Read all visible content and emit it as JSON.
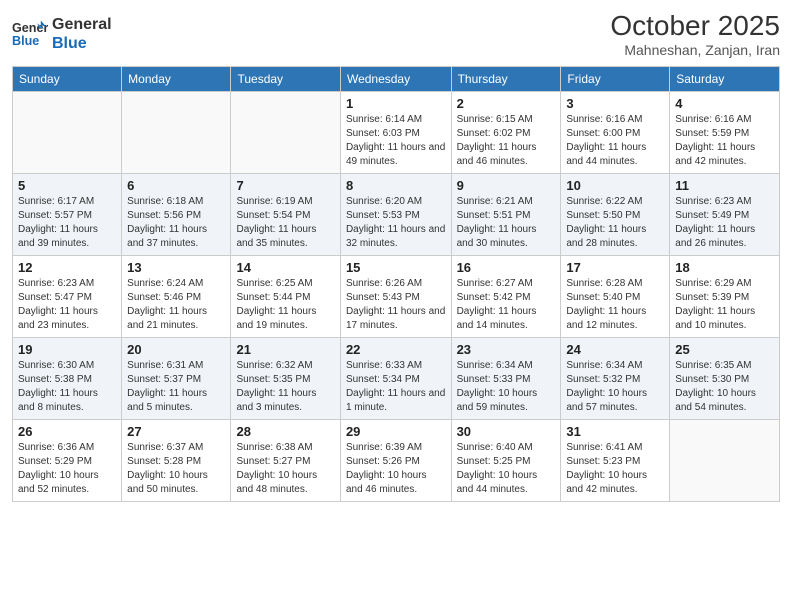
{
  "header": {
    "logo_line1": "General",
    "logo_line2": "Blue",
    "month": "October 2025",
    "location": "Mahneshan, Zanjan, Iran"
  },
  "weekdays": [
    "Sunday",
    "Monday",
    "Tuesday",
    "Wednesday",
    "Thursday",
    "Friday",
    "Saturday"
  ],
  "weeks": [
    [
      {
        "day": "",
        "info": ""
      },
      {
        "day": "",
        "info": ""
      },
      {
        "day": "",
        "info": ""
      },
      {
        "day": "1",
        "info": "Sunrise: 6:14 AM\nSunset: 6:03 PM\nDaylight: 11 hours and 49 minutes."
      },
      {
        "day": "2",
        "info": "Sunrise: 6:15 AM\nSunset: 6:02 PM\nDaylight: 11 hours and 46 minutes."
      },
      {
        "day": "3",
        "info": "Sunrise: 6:16 AM\nSunset: 6:00 PM\nDaylight: 11 hours and 44 minutes."
      },
      {
        "day": "4",
        "info": "Sunrise: 6:16 AM\nSunset: 5:59 PM\nDaylight: 11 hours and 42 minutes."
      }
    ],
    [
      {
        "day": "5",
        "info": "Sunrise: 6:17 AM\nSunset: 5:57 PM\nDaylight: 11 hours and 39 minutes."
      },
      {
        "day": "6",
        "info": "Sunrise: 6:18 AM\nSunset: 5:56 PM\nDaylight: 11 hours and 37 minutes."
      },
      {
        "day": "7",
        "info": "Sunrise: 6:19 AM\nSunset: 5:54 PM\nDaylight: 11 hours and 35 minutes."
      },
      {
        "day": "8",
        "info": "Sunrise: 6:20 AM\nSunset: 5:53 PM\nDaylight: 11 hours and 32 minutes."
      },
      {
        "day": "9",
        "info": "Sunrise: 6:21 AM\nSunset: 5:51 PM\nDaylight: 11 hours and 30 minutes."
      },
      {
        "day": "10",
        "info": "Sunrise: 6:22 AM\nSunset: 5:50 PM\nDaylight: 11 hours and 28 minutes."
      },
      {
        "day": "11",
        "info": "Sunrise: 6:23 AM\nSunset: 5:49 PM\nDaylight: 11 hours and 26 minutes."
      }
    ],
    [
      {
        "day": "12",
        "info": "Sunrise: 6:23 AM\nSunset: 5:47 PM\nDaylight: 11 hours and 23 minutes."
      },
      {
        "day": "13",
        "info": "Sunrise: 6:24 AM\nSunset: 5:46 PM\nDaylight: 11 hours and 21 minutes."
      },
      {
        "day": "14",
        "info": "Sunrise: 6:25 AM\nSunset: 5:44 PM\nDaylight: 11 hours and 19 minutes."
      },
      {
        "day": "15",
        "info": "Sunrise: 6:26 AM\nSunset: 5:43 PM\nDaylight: 11 hours and 17 minutes."
      },
      {
        "day": "16",
        "info": "Sunrise: 6:27 AM\nSunset: 5:42 PM\nDaylight: 11 hours and 14 minutes."
      },
      {
        "day": "17",
        "info": "Sunrise: 6:28 AM\nSunset: 5:40 PM\nDaylight: 11 hours and 12 minutes."
      },
      {
        "day": "18",
        "info": "Sunrise: 6:29 AM\nSunset: 5:39 PM\nDaylight: 11 hours and 10 minutes."
      }
    ],
    [
      {
        "day": "19",
        "info": "Sunrise: 6:30 AM\nSunset: 5:38 PM\nDaylight: 11 hours and 8 minutes."
      },
      {
        "day": "20",
        "info": "Sunrise: 6:31 AM\nSunset: 5:37 PM\nDaylight: 11 hours and 5 minutes."
      },
      {
        "day": "21",
        "info": "Sunrise: 6:32 AM\nSunset: 5:35 PM\nDaylight: 11 hours and 3 minutes."
      },
      {
        "day": "22",
        "info": "Sunrise: 6:33 AM\nSunset: 5:34 PM\nDaylight: 11 hours and 1 minute."
      },
      {
        "day": "23",
        "info": "Sunrise: 6:34 AM\nSunset: 5:33 PM\nDaylight: 10 hours and 59 minutes."
      },
      {
        "day": "24",
        "info": "Sunrise: 6:34 AM\nSunset: 5:32 PM\nDaylight: 10 hours and 57 minutes."
      },
      {
        "day": "25",
        "info": "Sunrise: 6:35 AM\nSunset: 5:30 PM\nDaylight: 10 hours and 54 minutes."
      }
    ],
    [
      {
        "day": "26",
        "info": "Sunrise: 6:36 AM\nSunset: 5:29 PM\nDaylight: 10 hours and 52 minutes."
      },
      {
        "day": "27",
        "info": "Sunrise: 6:37 AM\nSunset: 5:28 PM\nDaylight: 10 hours and 50 minutes."
      },
      {
        "day": "28",
        "info": "Sunrise: 6:38 AM\nSunset: 5:27 PM\nDaylight: 10 hours and 48 minutes."
      },
      {
        "day": "29",
        "info": "Sunrise: 6:39 AM\nSunset: 5:26 PM\nDaylight: 10 hours and 46 minutes."
      },
      {
        "day": "30",
        "info": "Sunrise: 6:40 AM\nSunset: 5:25 PM\nDaylight: 10 hours and 44 minutes."
      },
      {
        "day": "31",
        "info": "Sunrise: 6:41 AM\nSunset: 5:23 PM\nDaylight: 10 hours and 42 minutes."
      },
      {
        "day": "",
        "info": ""
      }
    ]
  ]
}
